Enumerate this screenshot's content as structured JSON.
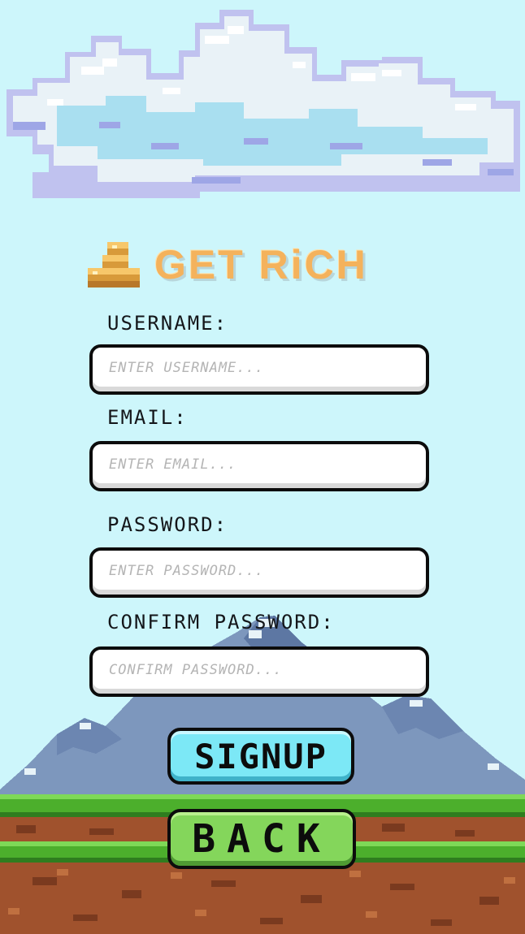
{
  "title": "GET RiCH",
  "form": {
    "username_label": "USERNAME:",
    "username_placeholder": "ENTER USERNAME...",
    "email_label": "EMAIL:",
    "email_placeholder": "ENTER EMAIL...",
    "password_label": "PASSWORD:",
    "password_placeholder": "ENTER PASSWORD...",
    "confirm_label": "CONFIRM PASSWORD:",
    "confirm_placeholder": "CONFIRM PASSWORD..."
  },
  "buttons": {
    "signup_label": "SIGNUP",
    "back_label": "BACK"
  },
  "colors": {
    "sky": "#cdf6fb",
    "title": "#f4b25c",
    "signup": "#7ce8f6",
    "back": "#84d65b",
    "grass": "#4caf2c",
    "dirt": "#a0522d"
  },
  "icons": {
    "logo": "coin-stack-icon"
  }
}
